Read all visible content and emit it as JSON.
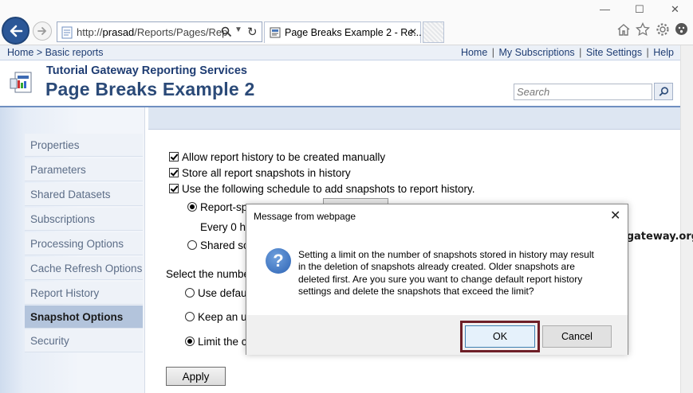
{
  "browser": {
    "url_prefix": "http://",
    "url_host": "prasad",
    "url_path": "/Reports/Pages/Rep",
    "tab_title": "Page Breaks Example 2 - Re...",
    "minimize": "—",
    "maximize": "☐",
    "close": "✕"
  },
  "header": {
    "breadcrumb": "Home > Basic reports",
    "links": [
      "Home",
      "My Subscriptions",
      "Site Settings",
      "Help"
    ],
    "app_name": "Tutorial Gateway Reporting Services",
    "page_title": "Page Breaks Example 2",
    "search_placeholder": "Search"
  },
  "sidebar": {
    "items": [
      {
        "label": "Properties"
      },
      {
        "label": "Parameters"
      },
      {
        "label": "Shared Datasets"
      },
      {
        "label": "Subscriptions"
      },
      {
        "label": "Processing Options"
      },
      {
        "label": "Cache Refresh Options"
      },
      {
        "label": "Report History"
      },
      {
        "label": "Snapshot Options",
        "active": true
      },
      {
        "label": "Security"
      }
    ]
  },
  "main": {
    "chk_manual": "Allow report history to be created manually",
    "chk_store": "Store all report snapshots in history",
    "chk_schedule": "Use the following schedule to add snapshots to report history.",
    "radio_report_specific": "Report-sp",
    "every_text": "Every 0 ho",
    "radio_shared": "Shared sc",
    "select_number": "Select the numbe",
    "radio_default": "Use defaul",
    "radio_keep": "Keep an u",
    "radio_limit": "Limit the c",
    "apply": "Apply"
  },
  "dialog": {
    "title": "Message from webpage",
    "message_lines": [
      "Setting a limit on the number of snapshots stored in history may result",
      "in the deletion of snapshots already created. Older snapshots are",
      "deleted first. Are you sure you want to change default report history",
      "settings and delete the snapshots that exceed the limit?"
    ],
    "ok": "OK",
    "cancel": "Cancel",
    "icon_glyph": "?"
  },
  "watermark": "©tutorialgateway.org"
}
